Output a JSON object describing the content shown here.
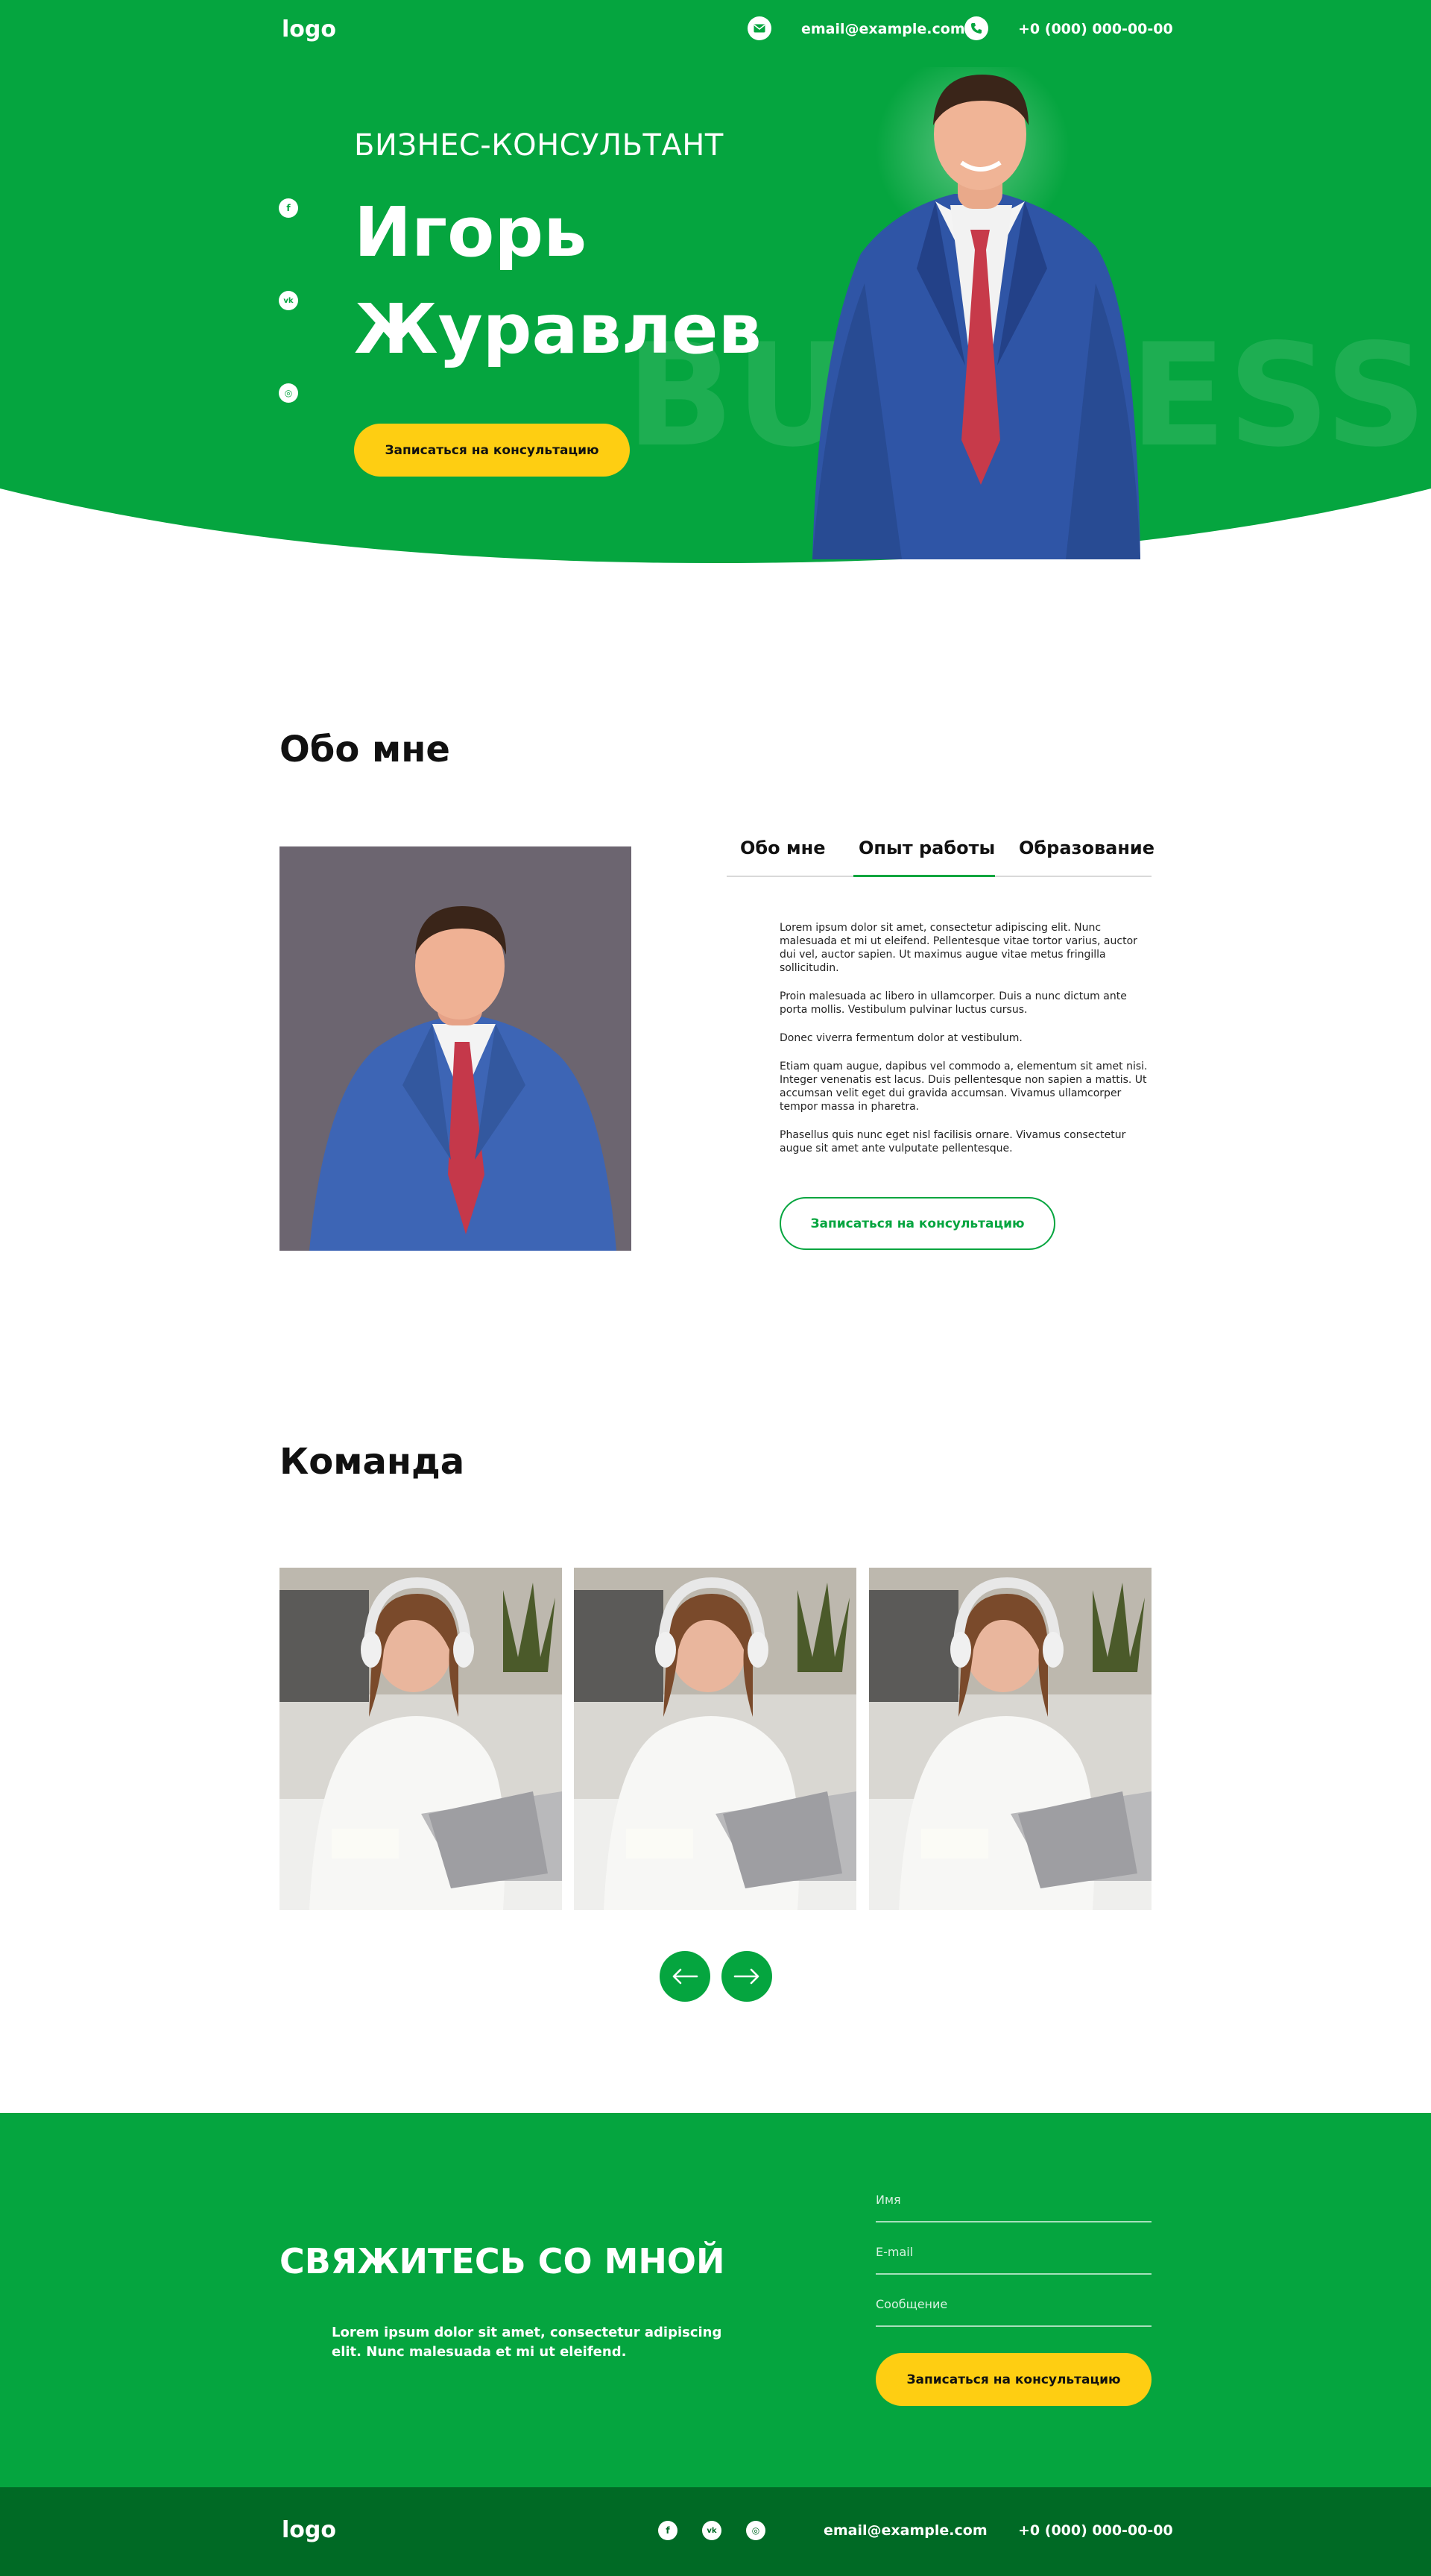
{
  "colors": {
    "primary_green": "#05a53f",
    "dark_green": "#006a25",
    "yellow": "#fece12",
    "text": "#111111",
    "white": "#ffffff"
  },
  "header": {
    "logo": "logo",
    "email": "email@example.com",
    "phone": "+0 (000) 000-00-00",
    "email_icon": "envelope-icon",
    "phone_icon": "phone-icon"
  },
  "hero": {
    "subtitle": "БИЗНЕС-КОНСУЛЬТАНТ",
    "first_name": "Игорь",
    "last_name": "Журавлев",
    "cta_label": "Записаться на консультацию",
    "watermark": "BUSINESS",
    "socials": [
      {
        "name": "facebook-icon",
        "glyph": "f"
      },
      {
        "name": "vk-icon",
        "glyph": "vk"
      },
      {
        "name": "instagram-icon",
        "glyph": "◎"
      }
    ]
  },
  "about": {
    "title": "Обо мне",
    "tabs": [
      {
        "label": "Обо мне",
        "active": false
      },
      {
        "label": "Опыт работы",
        "active": true
      },
      {
        "label": "Образование",
        "active": false
      }
    ],
    "paragraphs": [
      "Lorem ipsum dolor sit amet, consectetur adipiscing elit. Nunc malesuada et mi ut eleifend. Pellentesque vitae tortor varius, auctor dui vel, auctor sapien. Ut maximus augue vitae metus fringilla sollicitudin.",
      "Proin malesuada ac libero in ullamcorper. Duis a nunc dictum ante porta mollis. Vestibulum pulvinar luctus cursus.",
      "Donec viverra fermentum dolor at vestibulum.",
      "Etiam quam augue, dapibus vel commodo a, elementum sit amet nisi. Integer venenatis est lacus. Duis pellentesque non sapien a mattis. Ut accumsan velit eget dui gravida accumsan. Vivamus ullamcorper tempor massa in pharetra.",
      "Phasellus quis nunc eget nisl facilisis ornare. Vivamus consectetur augue sit amet ante vulputate pellentesque."
    ],
    "cta_label": "Записаться на консультацию"
  },
  "team": {
    "title": "Команда",
    "prev_icon": "arrow-left-icon",
    "next_icon": "arrow-right-icon"
  },
  "contact": {
    "title": "СВЯЖИТЕСЬ СО МНОЙ",
    "text": "Lorem ipsum dolor sit amet, consectetur adipiscing elit. Nunc malesuada et mi ut eleifend.",
    "name_placeholder": "Имя",
    "email_placeholder": "E-mail",
    "message_placeholder": "Сообщение",
    "submit_label": "Записаться на консультацию"
  },
  "footer": {
    "logo": "logo",
    "email": "email@example.com",
    "phone": "+0 (000) 000-00-00"
  }
}
